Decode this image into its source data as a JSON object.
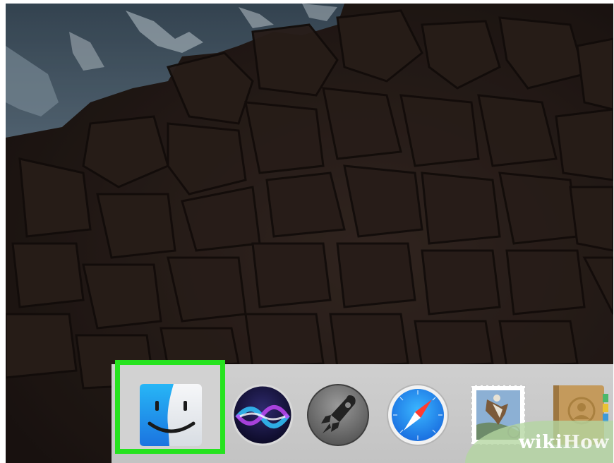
{
  "screen": {
    "description_wallpaper": "",
    "wallpaper_icon": "mountain-wallpaper"
  },
  "dock": {
    "highlight_color": "#26e31f",
    "items": [
      {
        "name": "finder",
        "icon": "finder-icon",
        "highlighted": true
      },
      {
        "name": "siri",
        "icon": "siri-icon"
      },
      {
        "name": "launchpad",
        "icon": "launchpad-icon"
      },
      {
        "name": "safari",
        "icon": "safari-icon"
      },
      {
        "name": "mail",
        "icon": "mail-icon"
      },
      {
        "name": "contacts",
        "icon": "contacts-icon"
      }
    ]
  },
  "watermark": {
    "part1": "wiki",
    "part2": "How"
  }
}
